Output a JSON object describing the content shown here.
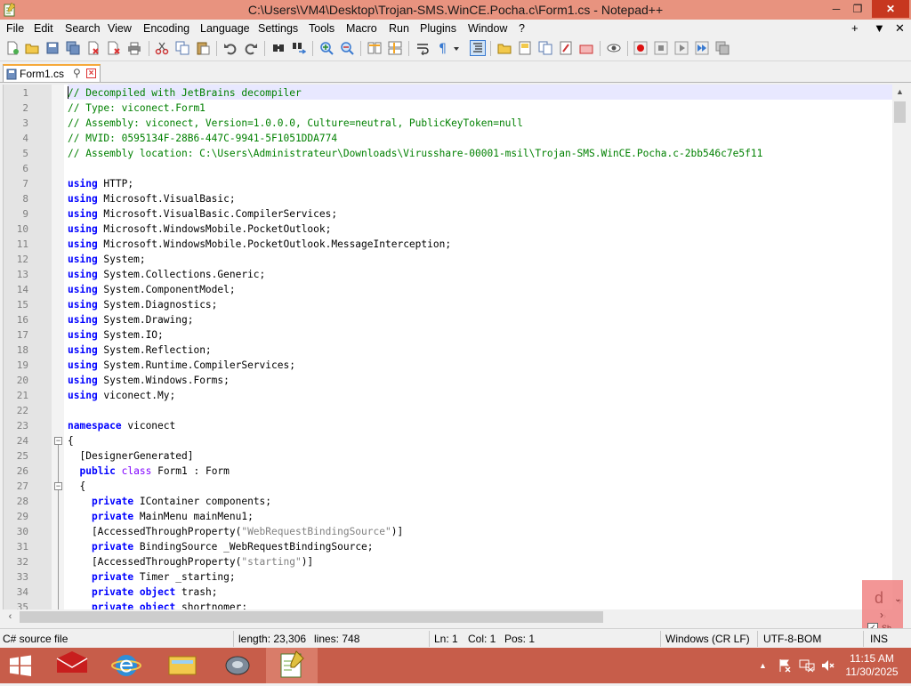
{
  "window": {
    "title": "C:\\Users\\VM4\\Desktop\\Trojan-SMS.WinCE.Pocha.c\\Form1.cs - Notepad++",
    "minimize_glyph": "─",
    "maximize_glyph": "❐",
    "close_glyph": "✕"
  },
  "menu": {
    "items": [
      "File",
      "Edit",
      "Search",
      "View",
      "Encoding",
      "Language",
      "Settings",
      "Tools",
      "Macro",
      "Run",
      "Plugins",
      "Window",
      "?"
    ],
    "right_plus": "+",
    "right_down": "▼",
    "right_close": "✕"
  },
  "toolbar": {
    "icons": [
      "new-file-icon",
      "open-file-icon",
      "save-icon",
      "save-all-icon",
      "close-icon",
      "close-all-icon",
      "print-icon",
      "cut-icon",
      "copy-icon",
      "paste-icon",
      "undo-icon",
      "redo-icon",
      "find-icon",
      "replace-icon",
      "zoom-in-icon",
      "zoom-out-icon",
      "sync-vertical-icon",
      "sync-horizontal-icon",
      "word-wrap-icon",
      "show-all-chars-icon",
      "indent-guide-icon",
      "folder-workspace-icon",
      "document-map-icon",
      "function-list-icon",
      "doc-switcher-icon",
      "monitor-icon",
      "record-macro-icon",
      "stop-macro-icon",
      "play-macro-icon",
      "run-macro-multiple-icon",
      "save-macro-icon"
    ]
  },
  "tab": {
    "name": "Form1.cs",
    "pin_glyph": "⚲",
    "close_glyph": "×"
  },
  "editor": {
    "lines": [
      [
        [
          "cm",
          "// Decompiled with JetBrains decompiler"
        ]
      ],
      [
        [
          "cm",
          "// Type: viconect.Form1"
        ]
      ],
      [
        [
          "cm",
          "// Assembly: viconect, Version=1.0.0.0, Culture=neutral, PublicKeyToken=null"
        ]
      ],
      [
        [
          "cm",
          "// MVID: 0595134F-28B6-447C-9941-5F1051DDA774"
        ]
      ],
      [
        [
          "cm",
          "// Assembly location: C:\\Users\\Administrateur\\Downloads\\Virusshare-00001-msil\\Trojan-SMS.WinCE.Pocha.c-2bb546c7e5f11"
        ]
      ],
      [],
      [
        [
          "kw",
          "using"
        ],
        [
          "ty",
          " HTTP;"
        ]
      ],
      [
        [
          "kw",
          "using"
        ],
        [
          "ty",
          " Microsoft.VisualBasic;"
        ]
      ],
      [
        [
          "kw",
          "using"
        ],
        [
          "ty",
          " Microsoft.VisualBasic.CompilerServices;"
        ]
      ],
      [
        [
          "kw",
          "using"
        ],
        [
          "ty",
          " Microsoft.WindowsMobile.PocketOutlook;"
        ]
      ],
      [
        [
          "kw",
          "using"
        ],
        [
          "ty",
          " Microsoft.WindowsMobile.PocketOutlook.MessageInterception;"
        ]
      ],
      [
        [
          "kw",
          "using"
        ],
        [
          "ty",
          " System;"
        ]
      ],
      [
        [
          "kw",
          "using"
        ],
        [
          "ty",
          " System.Collections.Generic;"
        ]
      ],
      [
        [
          "kw",
          "using"
        ],
        [
          "ty",
          " System.ComponentModel;"
        ]
      ],
      [
        [
          "kw",
          "using"
        ],
        [
          "ty",
          " System.Diagnostics;"
        ]
      ],
      [
        [
          "kw",
          "using"
        ],
        [
          "ty",
          " System.Drawing;"
        ]
      ],
      [
        [
          "kw",
          "using"
        ],
        [
          "ty",
          " System.IO;"
        ]
      ],
      [
        [
          "kw",
          "using"
        ],
        [
          "ty",
          " System.Reflection;"
        ]
      ],
      [
        [
          "kw",
          "using"
        ],
        [
          "ty",
          " System.Runtime.CompilerServices;"
        ]
      ],
      [
        [
          "kw",
          "using"
        ],
        [
          "ty",
          " System.Windows.Forms;"
        ]
      ],
      [
        [
          "kw",
          "using"
        ],
        [
          "ty",
          " viconect.My;"
        ]
      ],
      [],
      [
        [
          "kw",
          "namespace"
        ],
        [
          "ty",
          " viconect"
        ]
      ],
      [
        [
          "ty",
          "{"
        ]
      ],
      [
        [
          "ty",
          "  [DesignerGenerated]"
        ]
      ],
      [
        [
          "ty",
          "  "
        ],
        [
          "kw",
          "public"
        ],
        [
          "ty",
          " "
        ],
        [
          "kw2",
          "class"
        ],
        [
          "ty",
          " Form1 : Form"
        ]
      ],
      [
        [
          "ty",
          "  {"
        ]
      ],
      [
        [
          "ty",
          "    "
        ],
        [
          "kw",
          "private"
        ],
        [
          "ty",
          " IContainer components;"
        ]
      ],
      [
        [
          "ty",
          "    "
        ],
        [
          "kw",
          "private"
        ],
        [
          "ty",
          " MainMenu mainMenu1;"
        ]
      ],
      [
        [
          "ty",
          "    [AccessedThroughProperty("
        ],
        [
          "str",
          "\"WebRequestBindingSource\""
        ],
        [
          "ty",
          ")]"
        ]
      ],
      [
        [
          "ty",
          "    "
        ],
        [
          "kw",
          "private"
        ],
        [
          "ty",
          " BindingSource _WebRequestBindingSource;"
        ]
      ],
      [
        [
          "ty",
          "    [AccessedThroughProperty("
        ],
        [
          "str",
          "\"starting\""
        ],
        [
          "ty",
          ")]"
        ]
      ],
      [
        [
          "ty",
          "    "
        ],
        [
          "kw",
          "private"
        ],
        [
          "ty",
          " Timer _starting;"
        ]
      ],
      [
        [
          "ty",
          "    "
        ],
        [
          "kw",
          "private"
        ],
        [
          "ty",
          " "
        ],
        [
          "kw",
          "object"
        ],
        [
          "ty",
          " trash;"
        ]
      ],
      [
        [
          "ty",
          "    "
        ],
        [
          "kw",
          "private"
        ],
        [
          "ty",
          " "
        ],
        [
          "kw",
          "object"
        ],
        [
          "ty",
          " shortnomer;"
        ]
      ]
    ],
    "fold_lines": [
      24,
      27
    ]
  },
  "overlay": {
    "letter": "d",
    "arrow": "›",
    "chevron": "⌄",
    "check": "✓",
    "caption": "Sh"
  },
  "status": {
    "file_type": "C# source file",
    "length": "length: 23,306",
    "lines": "lines: 748",
    "ln": "Ln: 1",
    "col": "Col: 1",
    "pos": "Pos: 1",
    "eol": "Windows (CR LF)",
    "encoding": "UTF-8-BOM",
    "mode": "INS"
  },
  "taskbar": {
    "time": "11:15 AM",
    "date": "11/30/2025",
    "tray_up": "▲"
  },
  "colors": {
    "titlebar": "#e8937f",
    "taskbar": "#c75d4a",
    "comment": "#008000",
    "keyword": "#0000ff",
    "keyword_class": "#8000ff",
    "current_line": "#e8e8ff"
  }
}
